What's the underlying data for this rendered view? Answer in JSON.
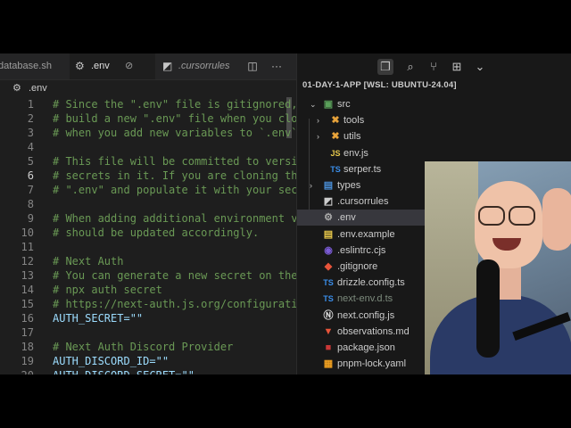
{
  "tabs": [
    {
      "label": "database.sh",
      "icon": "shell-icon",
      "active": false
    },
    {
      "label": ".env",
      "icon": "gear-icon",
      "active": true
    },
    {
      "label": ".cursorrules",
      "icon": "cursor-icon",
      "active": false
    }
  ],
  "breadcrumb": {
    "file": ".env",
    "icon": "gear-icon"
  },
  "editor": {
    "lines": [
      {
        "n": "1",
        "text": "# Since the \".env\" file is gitignored,"
      },
      {
        "n": "2",
        "text": "# build a new \".env\" file when you clo"
      },
      {
        "n": "3",
        "text": "# when you add new variables to `.env`"
      },
      {
        "n": "4",
        "text": ""
      },
      {
        "n": "5",
        "text": "# This file will be committed to versi"
      },
      {
        "n": "6",
        "text": "# secrets in it. If you are cloning th"
      },
      {
        "n": "7",
        "text": "# \".env\" and populate it with your sec"
      },
      {
        "n": "8",
        "text": ""
      },
      {
        "n": "9",
        "text": "# When adding additional environment v"
      },
      {
        "n": "10",
        "text": "# should be updated accordingly."
      },
      {
        "n": "11",
        "text": ""
      },
      {
        "n": "12",
        "text": "# Next Auth"
      },
      {
        "n": "13",
        "text": "# You can generate a new secret on the"
      },
      {
        "n": "14",
        "text": "# npx auth secret"
      },
      {
        "n": "15",
        "text": "# https://next-auth.js.org/configurati"
      },
      {
        "n": "16",
        "text": "AUTH_SECRET=\"\""
      },
      {
        "n": "17",
        "text": ""
      },
      {
        "n": "18",
        "text": "# Next Auth Discord Provider"
      },
      {
        "n": "19",
        "text": "AUTH_DISCORD_ID=\"\""
      },
      {
        "n": "20",
        "text": "AUTH_DISCORD_SECRET=\"\""
      }
    ]
  },
  "explorer": {
    "title": "01-DAY-1-APP [WSL: UBUNTU-24.04]",
    "items": [
      {
        "label": "src",
        "icon": "folder-src-icon",
        "chevron": "⌄"
      },
      {
        "label": "tools",
        "icon": "folder-tools-icon",
        "chevron": "›"
      },
      {
        "label": "utils",
        "icon": "folder-utils-icon",
        "chevron": "›"
      },
      {
        "label": "env.js",
        "icon": "js-icon",
        "badge": "JS"
      },
      {
        "label": "serper.ts",
        "icon": "ts-icon",
        "badge": "TS"
      },
      {
        "label": "types",
        "icon": "folder-types-icon",
        "chevron": "›"
      },
      {
        "label": ".cursorrules",
        "icon": "cursor-icon"
      },
      {
        "label": ".env",
        "icon": "gear-icon"
      },
      {
        "label": ".env.example",
        "icon": "env-icon"
      },
      {
        "label": ".eslintrc.cjs",
        "icon": "eslint-icon"
      },
      {
        "label": ".gitignore",
        "icon": "git-icon"
      },
      {
        "label": "drizzle.config.ts",
        "icon": "ts-icon",
        "badge": "TS"
      },
      {
        "label": "next-env.d.ts",
        "icon": "ts-d-icon",
        "badge": "TS"
      },
      {
        "label": "next.config.js",
        "icon": "next-icon"
      },
      {
        "label": "observations.md",
        "icon": "markdown-icon"
      },
      {
        "label": "package.json",
        "icon": "npm-icon"
      },
      {
        "label": "pnpm-lock.yaml",
        "icon": "pnpm-icon"
      }
    ]
  },
  "colors": {
    "comment": "#6a9955",
    "variable": "#9cdcfe",
    "ts": "#3b8eea",
    "js": "#e6c84c",
    "folder": "#dcb67a"
  }
}
